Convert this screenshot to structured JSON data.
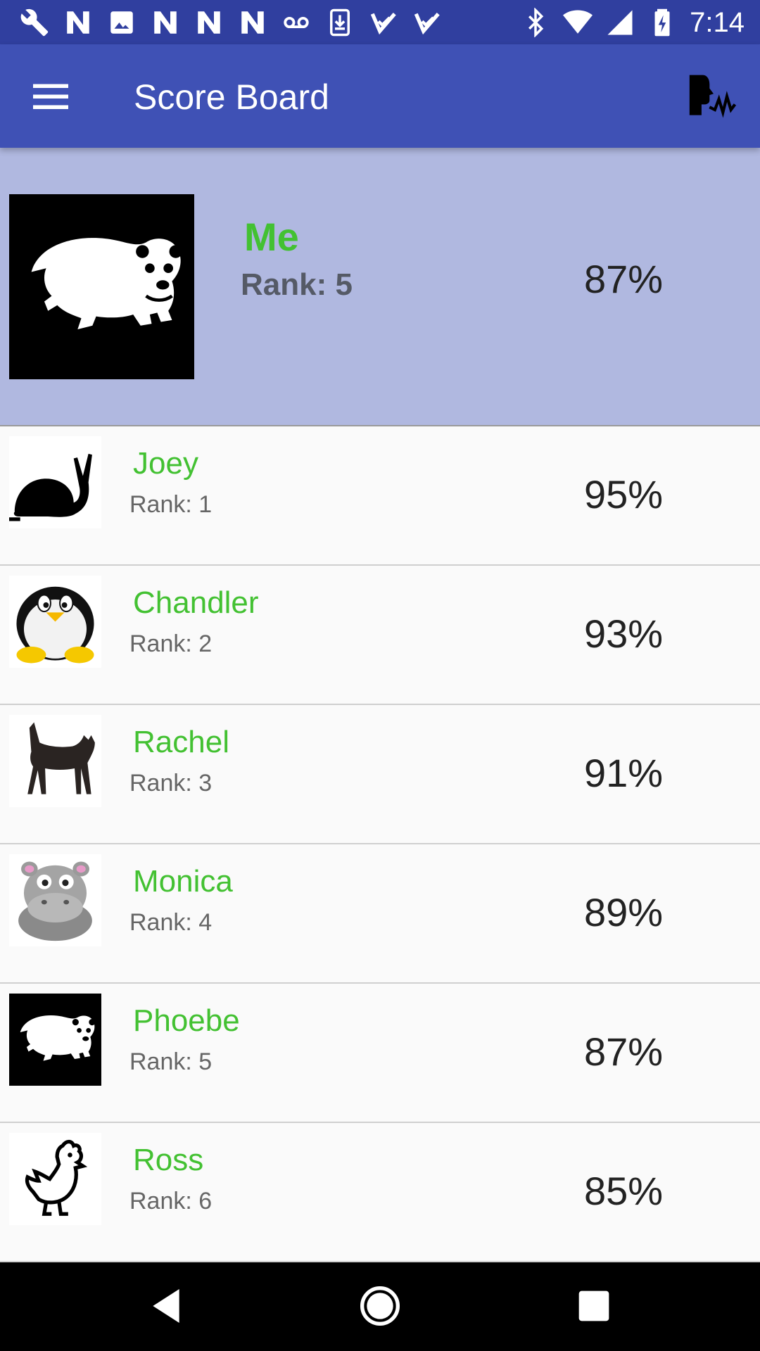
{
  "status_bar": {
    "time": "7:14",
    "left_icons": [
      "wrench-icon",
      "n-icon",
      "image-icon",
      "n-icon",
      "n-icon",
      "n-icon",
      "voicemail-icon",
      "download-icon",
      "check-icon",
      "check-icon"
    ],
    "right_icons": [
      "bluetooth-icon",
      "wifi-icon",
      "signal-icon",
      "battery-icon"
    ]
  },
  "app_bar": {
    "title": "Score Board",
    "menu_icon": "hamburger-icon",
    "action_icon": "voice-wave-icon",
    "color": "#3f51b5"
  },
  "me": {
    "name": "Me",
    "rank": "Rank: 5",
    "score": "87%",
    "avatar": "polar-bear-icon"
  },
  "players": [
    {
      "name": "Joey",
      "rank": "Rank: 1",
      "score": "95%",
      "avatar": "snail-icon"
    },
    {
      "name": "Chandler",
      "rank": "Rank: 2",
      "score": "93%",
      "avatar": "penguin-icon"
    },
    {
      "name": "Rachel",
      "rank": "Rank: 3",
      "score": "91%",
      "avatar": "cat-icon"
    },
    {
      "name": "Monica",
      "rank": "Rank: 4",
      "score": "89%",
      "avatar": "hippo-icon"
    },
    {
      "name": "Phoebe",
      "rank": "Rank: 5",
      "score": "87%",
      "avatar": "polar-bear-icon"
    },
    {
      "name": "Ross",
      "rank": "Rank: 6",
      "score": "85%",
      "avatar": "chicken-icon"
    }
  ],
  "nav_bar": {
    "back": "back-icon",
    "home": "home-icon",
    "recents": "recents-icon"
  },
  "colors": {
    "name_green": "#43c132",
    "highlight": "#b0b8e0",
    "status_bar": "#303f9f"
  }
}
